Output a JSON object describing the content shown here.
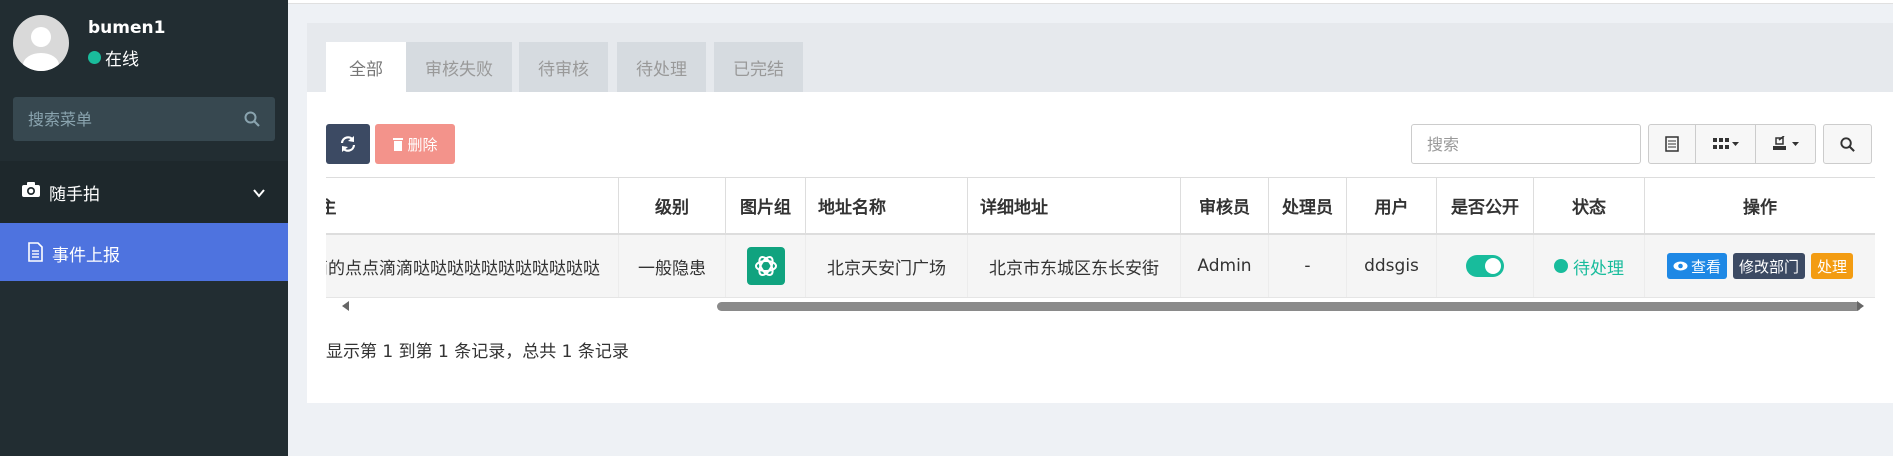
{
  "user": {
    "name": "bumen1",
    "status": "在线"
  },
  "sidebar": {
    "search_placeholder": "搜索菜单",
    "group_label": "随手拍",
    "sub_item_label": "事件上报",
    "status_color": "#1abc9c"
  },
  "tabs": [
    {
      "label": "全部",
      "active": true
    },
    {
      "label": "审核失败",
      "active": false
    },
    {
      "label": "待审核",
      "active": false
    },
    {
      "label": "待处理",
      "active": false
    },
    {
      "label": "已完结",
      "active": false
    }
  ],
  "toolbar": {
    "delete_label": "删除",
    "search_placeholder": "搜索"
  },
  "table": {
    "headers": {
      "title": "主",
      "level": "级别",
      "images": "图片组",
      "address_name": "地址名称",
      "address_detail": "详细地址",
      "reviewer": "审核员",
      "handler": "处理员",
      "user": "用户",
      "public": "是否公开",
      "status": "状态",
      "actions": "操作"
    },
    "rows": [
      {
        "title": "滴滴的点点滴滴哒哒哒哒哒哒哒哒哒哒哒",
        "level": "一般隐患",
        "address_name": "北京天安门广场",
        "address_detail": "北京市东城区东长安街",
        "reviewer": "Admin",
        "handler": "-",
        "user": "ddsgis",
        "public": true,
        "status": "待处理",
        "actions": {
          "view": "查看",
          "edit_dept": "修改部门",
          "handle": "处理"
        }
      }
    ]
  },
  "summary": "显示第 1 到第 1 条记录，总共 1 条记录",
  "colors": {
    "accent": "#4e73df",
    "success": "#18bc9c",
    "danger_light": "#f3938b",
    "info": "#1e88e5",
    "dark": "#3c4a63",
    "warning": "#f39c12"
  }
}
